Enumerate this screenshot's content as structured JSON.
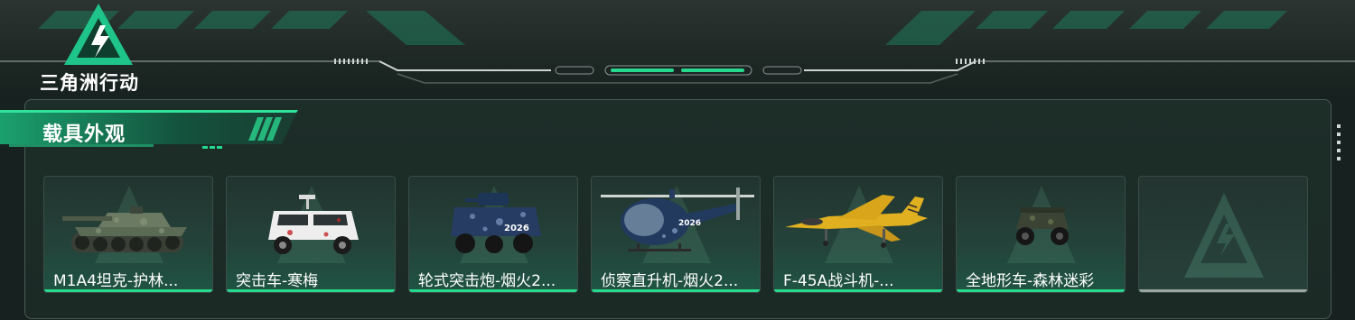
{
  "brand": {
    "logo_text": "三角洲行动",
    "accent_color": "#27d98e"
  },
  "section": {
    "title": "载具外观"
  },
  "vehicles": [
    {
      "label": "M1A4坦克-护林...",
      "icon": "tank-icon"
    },
    {
      "label": "突击车-寒梅",
      "icon": "assault-vehicle-icon"
    },
    {
      "label": "轮式突击炮-烟火2...",
      "icon": "wheeled-gun-icon"
    },
    {
      "label": "侦察直升机-烟火2...",
      "icon": "helicopter-icon"
    },
    {
      "label": "F-45A战斗机-...",
      "icon": "fighter-jet-icon"
    },
    {
      "label": "全地形车-森林迷彩",
      "icon": "atv-icon"
    },
    {
      "label": "",
      "icon": "empty-slot-icon"
    }
  ]
}
